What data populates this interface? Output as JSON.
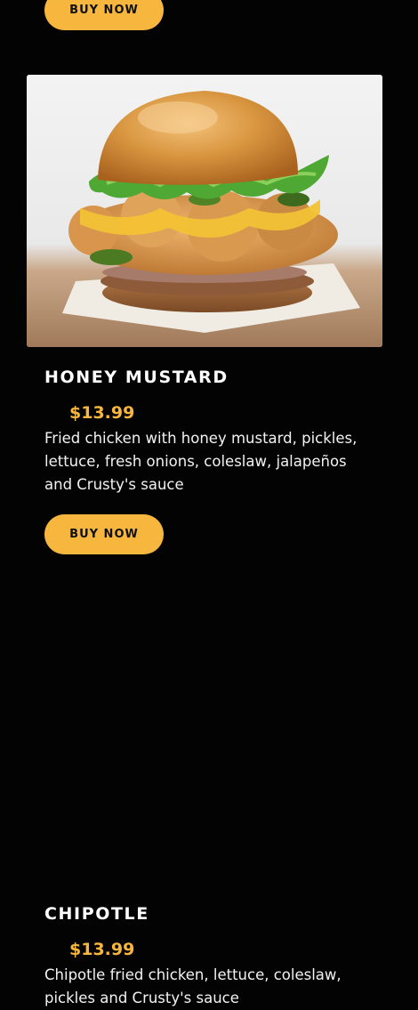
{
  "products": [
    {
      "buy_label": "BUY NOW"
    },
    {
      "image_alt": "honey-mustard-sandwich-photo",
      "title": "HONEY MUSTARD",
      "price": "$13.99",
      "description": "Fried chicken with honey mustard, pickles, lettuce, fresh onions, coleslaw, jalapeños and Crusty's sauce",
      "buy_label": "BUY NOW"
    },
    {
      "title": "CHIPOTLE",
      "price": "$13.99",
      "description": "Chipotle fried chicken, lettuce, coleslaw, pickles and Crusty's sauce"
    }
  ],
  "colors": {
    "background": "#030303",
    "accent": "#f7b63e",
    "text": "#ffffff"
  }
}
